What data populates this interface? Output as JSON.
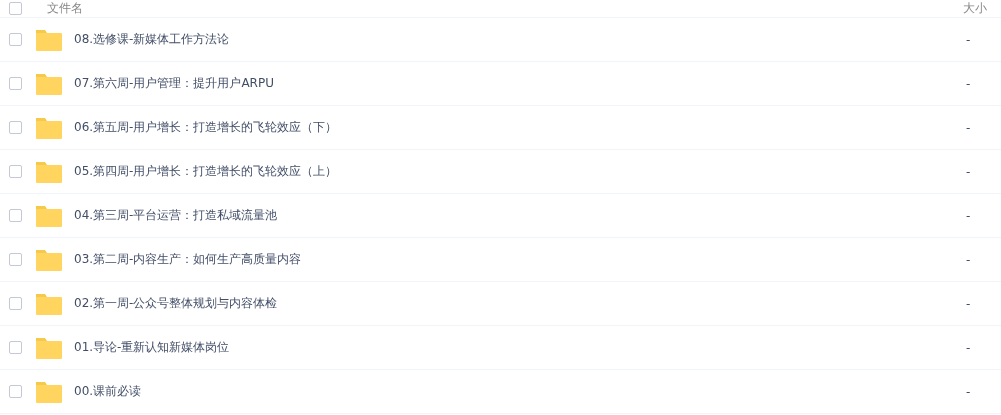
{
  "header": {
    "checked": false,
    "name_label": "文件名",
    "size_label": "大小"
  },
  "files": [
    {
      "name": "08.选修课-新媒体工作方法论",
      "size": "-",
      "checked": false
    },
    {
      "name": "07.第六周-用户管理：提升用户ARPU",
      "size": "-",
      "checked": false
    },
    {
      "name": "06.第五周-用户增长：打造增长的飞轮效应（下）",
      "size": "-",
      "checked": false
    },
    {
      "name": "05.第四周-用户增长：打造增长的飞轮效应（上）",
      "size": "-",
      "checked": false
    },
    {
      "name": "04.第三周-平台运营：打造私域流量池",
      "size": "-",
      "checked": false
    },
    {
      "name": "03.第二周-内容生产：如何生产高质量内容",
      "size": "-",
      "checked": false
    },
    {
      "name": "02.第一周-公众号整体规划与内容体检",
      "size": "-",
      "checked": false
    },
    {
      "name": "01.导论-重新认知新媒体岗位",
      "size": "-",
      "checked": false
    },
    {
      "name": "00.课前必读",
      "size": "-",
      "checked": false
    }
  ]
}
